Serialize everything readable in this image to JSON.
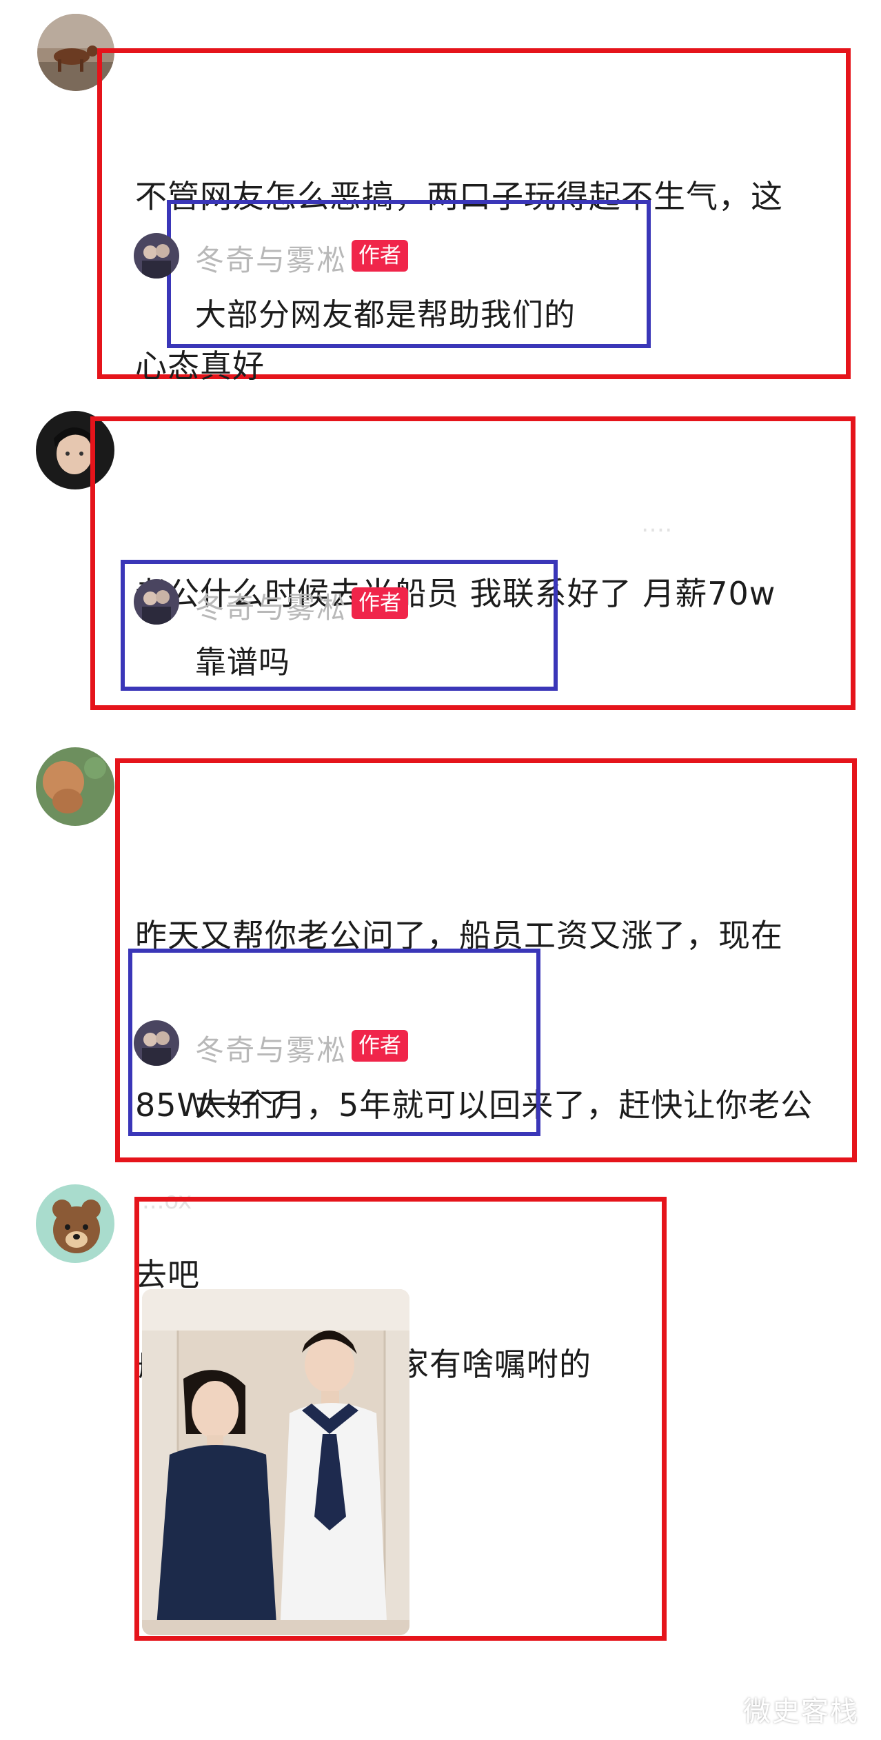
{
  "comments": [
    {
      "text_lines": [
        "不管网友怎么恶搞，两口子玩得起不生气，这",
        "心态真好"
      ],
      "reply": {
        "name": "冬奇与雾凇",
        "badge": "作者",
        "text": "大部分网友都是帮助我们的"
      }
    },
    {
      "text_lines": [
        "老公什么时候去当船员 我联系好了 月薪70w"
      ],
      "reply": {
        "name": "冬奇与雾凇",
        "badge": "作者",
        "text": "靠谱吗"
      }
    },
    {
      "text_lines": [
        "昨天又帮你老公问了，船员工资又涨了，现在",
        "85W一个月，5年就可以回来了，赶快让你老公",
        "去吧"
      ],
      "reply": {
        "name": "冬奇与雾凇",
        "badge": "作者",
        "text": "太好了"
      }
    },
    {
      "text_lines": [
        "船员即将上船，大家有啥嘱咐的"
      ],
      "faded_username": "...ox"
    }
  ],
  "watermark": "微史客栈",
  "colors": {
    "highlight_red": "#e5141b",
    "highlight_blue": "#3a36b8",
    "badge": "#f0254a",
    "name_gray": "#b8b8b8"
  }
}
